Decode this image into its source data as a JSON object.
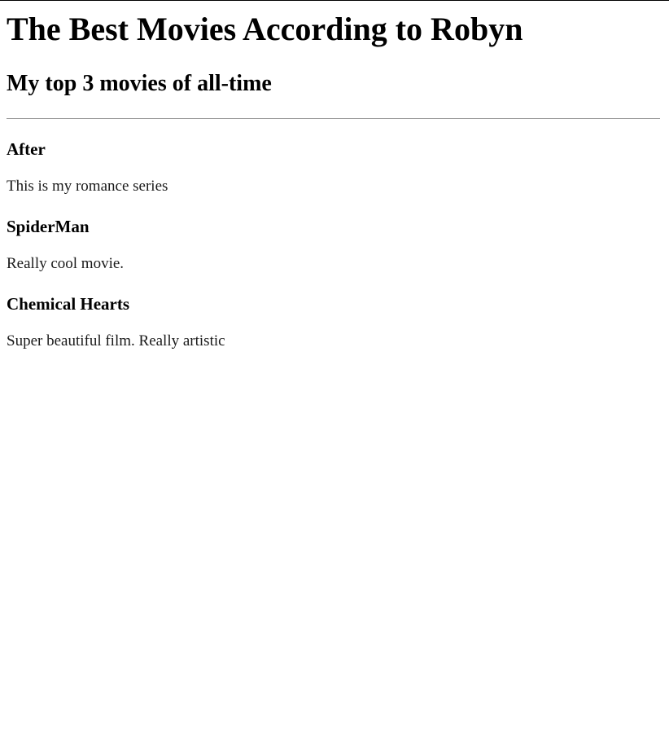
{
  "page": {
    "title": "The Best Movies According to Robyn",
    "subtitle": "My top 3 movies of all-time"
  },
  "movies": [
    {
      "title": "After",
      "description": "This is my romance series"
    },
    {
      "title": "SpiderMan",
      "description": "Really cool movie."
    },
    {
      "title": "Chemical Hearts",
      "description": "Super beautiful film. Really artistic"
    }
  ]
}
